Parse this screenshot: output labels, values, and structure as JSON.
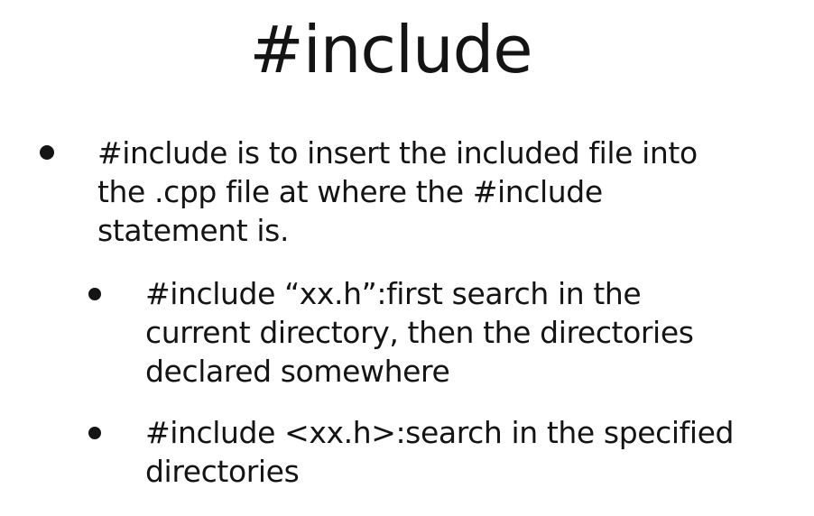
{
  "slide": {
    "title": "#include",
    "bullets": [
      {
        "lines": [
          "#include is to insert the included file into",
          "the .cpp file at where the #include",
          "statement is."
        ],
        "sub_bullets": [
          {
            "lines": [
              "#include “xx.h”:first search in the",
              "current directory, then the directories",
              "declared somewhere"
            ]
          },
          {
            "lines": [
              "#include <xx.h>:search in the specified",
              "directories"
            ]
          }
        ]
      }
    ]
  }
}
